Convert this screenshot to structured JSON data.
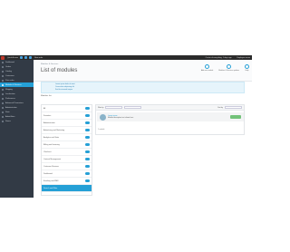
{
  "topbar": {
    "quick_access": "Quick Access",
    "new_order": "New order",
    "right_text": "Center of everything, 1 days ago",
    "user": "Employee name"
  },
  "sidebar": {
    "items": [
      "Dashboard",
      "Orders",
      "Catalog",
      "Customers",
      "Price rules",
      "Modules & Services",
      "Shipping",
      "Localization",
      "Preferences",
      "Advanced Parameters",
      "Administration",
      "Stats",
      "AdminStore",
      "Stores"
    ]
  },
  "header": {
    "breadcrumb": "Modules & Services",
    "title": "List of modules",
    "toolbar": [
      "Add new module",
      "Modules & Services updates",
      "Help"
    ]
  },
  "info": {
    "lines": [
      "Lorem ipsum dolor sit amet",
      "Consectetur adipiscing elit",
      "Sed do eiusmod tempor"
    ]
  },
  "filters": {
    "title": "Modules list",
    "items": [
      "All",
      "Favorites",
      "Administration",
      "Advertising and Marketing",
      "Analytics and Stats",
      "Billing and Invoicing",
      "Checkout",
      "Content Management",
      "Customer Reviews",
      "Dashboard",
      "Emailing and SMS",
      "Export",
      "Search and Filter"
    ],
    "active": "Search and Filter"
  },
  "list": {
    "filter_label": "Filter by",
    "sort_label": "Sort by",
    "module_name": "Lorem ipsum",
    "module_desc": "Module description text shown here",
    "count": "1 module"
  }
}
